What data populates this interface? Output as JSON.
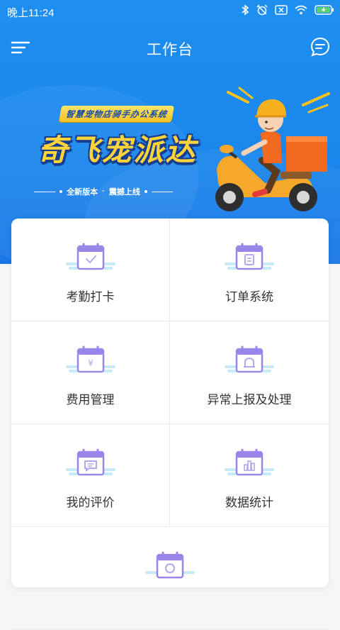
{
  "status_bar": {
    "time": "晚上11:24",
    "icons": [
      "bluetooth-icon",
      "alarm-off-icon",
      "sim-off-icon",
      "wifi-icon",
      "battery-charging-icon"
    ],
    "battery_color": "#5ad16a"
  },
  "header": {
    "title": "工作台",
    "menu_icon": "menu-icon",
    "message_icon": "message-icon"
  },
  "banner": {
    "subtitle": "智慧宠物店骑手办公系统",
    "title": "奇飞宠派达",
    "tagline_left": "全新版本",
    "tagline_right": "震撼上线",
    "title_color": "#ffd43a"
  },
  "grid": {
    "items": [
      {
        "label": "考勤打卡",
        "icon": "calendar-check-icon"
      },
      {
        "label": "订单系统",
        "icon": "calendar-list-icon"
      },
      {
        "label": "费用管理",
        "icon": "calendar-yen-icon"
      },
      {
        "label": "异常上报及处理",
        "icon": "calendar-alarm-icon"
      },
      {
        "label": "我的评价",
        "icon": "calendar-comment-icon"
      },
      {
        "label": "数据统计",
        "icon": "calendar-chart-icon"
      },
      {
        "label": "",
        "icon": "calendar-icon"
      }
    ]
  },
  "colors": {
    "primary": "#1a86ec",
    "icon_purple": "#9a86e8",
    "icon_shadow": "#c8e9f6"
  }
}
